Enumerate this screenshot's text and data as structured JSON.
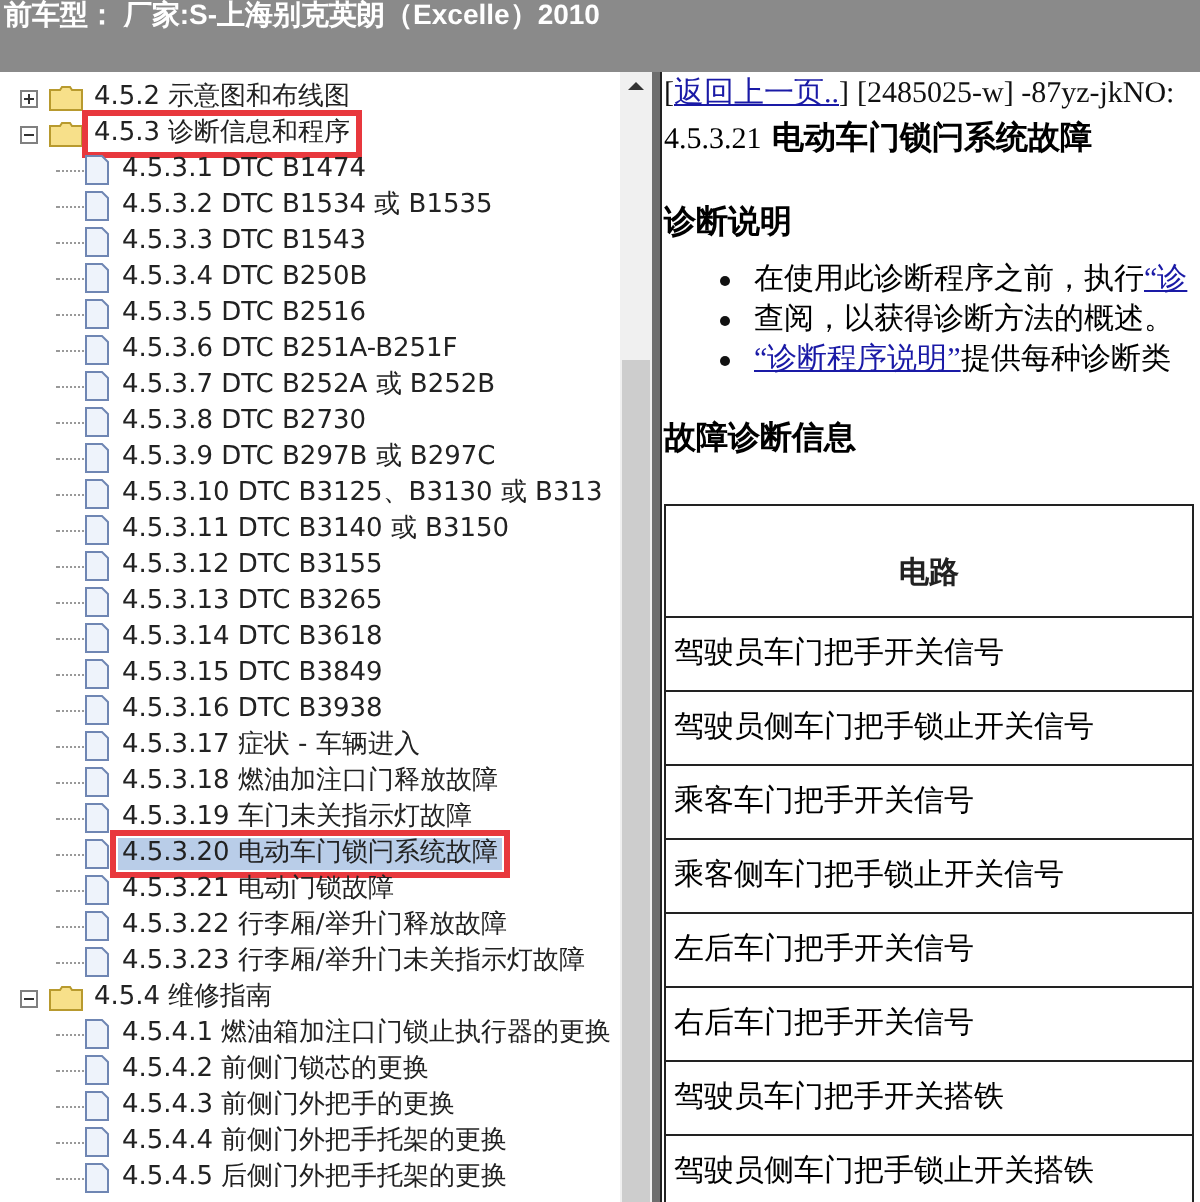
{
  "header": {
    "title": "前车型： 厂家:S-上海别克英朗（Excelle）2010"
  },
  "tree": [
    {
      "label": "4.5.2 示意图和布线图",
      "expanded": false,
      "selected": false,
      "highlighted": false
    },
    {
      "label": "4.5.3 诊断信息和程序",
      "expanded": true,
      "selected": false,
      "highlighted": true,
      "children": [
        {
          "label": "4.5.3.1 DTC B1474",
          "selected": false,
          "highlighted": false
        },
        {
          "label": "4.5.3.2 DTC B1534 或 B1535",
          "selected": false,
          "highlighted": false
        },
        {
          "label": "4.5.3.3 DTC B1543",
          "selected": false,
          "highlighted": false
        },
        {
          "label": "4.5.3.4 DTC B250B",
          "selected": false,
          "highlighted": false
        },
        {
          "label": "4.5.3.5 DTC B2516",
          "selected": false,
          "highlighted": false
        },
        {
          "label": "4.5.3.6 DTC B251A-B251F",
          "selected": false,
          "highlighted": false
        },
        {
          "label": "4.5.3.7 DTC B252A 或 B252B",
          "selected": false,
          "highlighted": false
        },
        {
          "label": "4.5.3.8 DTC B2730",
          "selected": false,
          "highlighted": false
        },
        {
          "label": "4.5.3.9 DTC B297B 或 B297C",
          "selected": false,
          "highlighted": false
        },
        {
          "label": "4.5.3.10 DTC B3125、B3130 或 B313",
          "selected": false,
          "highlighted": false
        },
        {
          "label": "4.5.3.11 DTC B3140 或 B3150",
          "selected": false,
          "highlighted": false
        },
        {
          "label": "4.5.3.12 DTC B3155",
          "selected": false,
          "highlighted": false
        },
        {
          "label": "4.5.3.13 DTC B3265",
          "selected": false,
          "highlighted": false
        },
        {
          "label": "4.5.3.14 DTC B3618",
          "selected": false,
          "highlighted": false
        },
        {
          "label": "4.5.3.15 DTC B3849",
          "selected": false,
          "highlighted": false
        },
        {
          "label": "4.5.3.16 DTC B3938",
          "selected": false,
          "highlighted": false
        },
        {
          "label": "4.5.3.17 症状 - 车辆进入",
          "selected": false,
          "highlighted": false
        },
        {
          "label": "4.5.3.18 燃油加注口门释放故障",
          "selected": false,
          "highlighted": false
        },
        {
          "label": "4.5.3.19 车门未关指示灯故障",
          "selected": false,
          "highlighted": false
        },
        {
          "label": "4.5.3.20 电动车门锁闩系统故障",
          "selected": true,
          "highlighted": true
        },
        {
          "label": "4.5.3.21 电动门锁故障",
          "selected": false,
          "highlighted": false
        },
        {
          "label": "4.5.3.22 行李厢/举升门释放故障",
          "selected": false,
          "highlighted": false
        },
        {
          "label": "4.5.3.23 行李厢/举升门未关指示灯故障",
          "selected": false,
          "highlighted": false
        }
      ]
    },
    {
      "label": "4.5.4 维修指南",
      "expanded": true,
      "selected": false,
      "highlighted": false,
      "children": [
        {
          "label": "4.5.4.1 燃油箱加注口门锁止执行器的更换",
          "selected": false,
          "highlighted": false
        },
        {
          "label": "4.5.4.2 前侧门锁芯的更换",
          "selected": false,
          "highlighted": false
        },
        {
          "label": "4.5.4.3 前侧门外把手的更换",
          "selected": false,
          "highlighted": false
        },
        {
          "label": "4.5.4.4 前侧门外把手托架的更换",
          "selected": false,
          "highlighted": false
        },
        {
          "label": "4.5.4.5 后侧门外把手托架的更换",
          "selected": false,
          "highlighted": false
        }
      ]
    }
  ],
  "content": {
    "open_bracket": "[",
    "back_link": "返回上一页..",
    "close_bracket": "]",
    "doc_id": "[2485025-w] -87yz-jkNO:",
    "title_number": "4.5.3.21",
    "title": "电动车门锁闩系统故障",
    "section_1": "诊断说明",
    "bullets": [
      {
        "text": "在使用此诊断程序之前，执行",
        "link": "“诊"
      },
      {
        "text": "查阅，以获得诊断方法的概述。"
      },
      {
        "link": "“诊断程序说明”",
        "after": "提供每种诊断类"
      }
    ],
    "section_2": "故障诊断信息",
    "table": {
      "columns": [
        "电路"
      ],
      "rows": [
        "驾驶员车门把手开关信号",
        "驾驶员侧车门把手锁止开关信号",
        "乘客车门把手开关信号",
        "乘客侧车门把手锁止开关信号",
        "左后车门把手开关信号",
        "右后车门把手开关信号",
        "驾驶员车门把手开关搭铁",
        "驾驶员侧车门把手锁止开关搭铁"
      ]
    }
  }
}
